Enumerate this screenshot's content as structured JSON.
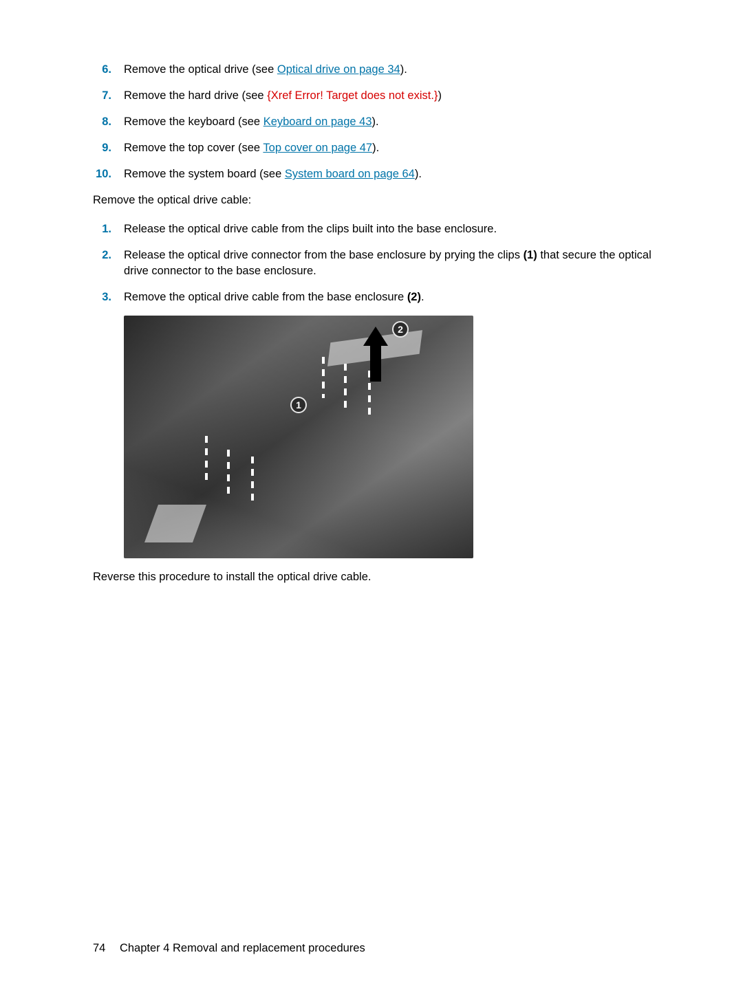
{
  "listA": [
    {
      "n": "6.",
      "pre": "Remove the optical drive (see ",
      "link": "Optical drive on page 34",
      "post": ")."
    },
    {
      "n": "7.",
      "pre": "Remove the hard drive (see ",
      "err": "{Xref Error! Target does not exist.}",
      "post": ")"
    },
    {
      "n": "8.",
      "pre": "Remove the keyboard (see ",
      "link": "Keyboard on page 43",
      "post": ")."
    },
    {
      "n": "9.",
      "pre": "Remove the top cover (see ",
      "link": "Top cover on page 47",
      "post": ")."
    },
    {
      "n": "10.",
      "pre": "Remove the system board (see ",
      "link": "System board on page 64",
      "post": ")."
    }
  ],
  "intro2": "Remove the optical drive cable:",
  "listB": [
    {
      "n": "1.",
      "text": "Release the optical drive cable from the clips built into the base enclosure."
    },
    {
      "n": "2.",
      "text_a": "Release the optical drive connector from the base enclosure by prying the clips ",
      "bold1": "(1)",
      "text_b": " that secure the optical drive connector to the base enclosure."
    },
    {
      "n": "3.",
      "text_a": "Remove the optical drive cable from the base enclosure ",
      "bold1": "(2)",
      "text_b": "."
    }
  ],
  "callouts": {
    "one": "1",
    "two": "2"
  },
  "closing": "Reverse this procedure to install the optical drive cable.",
  "footer": {
    "page": "74",
    "chapter": "Chapter 4   Removal and replacement procedures"
  }
}
